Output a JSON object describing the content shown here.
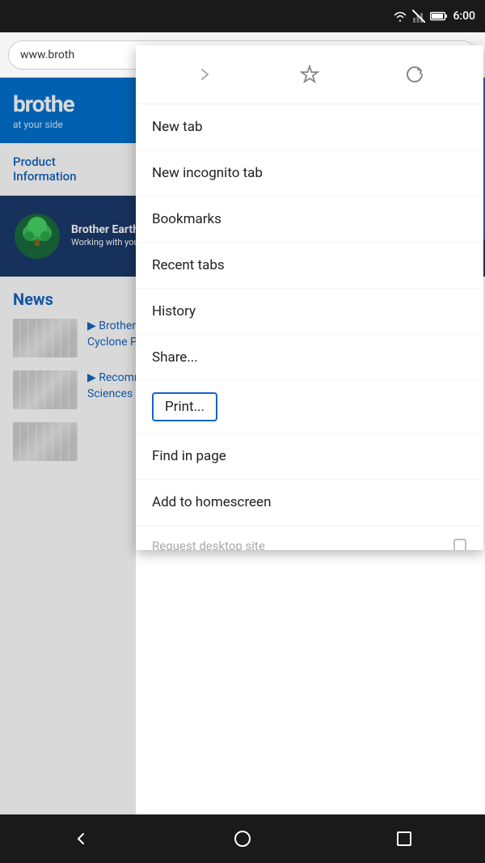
{
  "statusBar": {
    "time": "6:00",
    "wifiIcon": "wifi-icon",
    "batteryIcon": "battery-icon",
    "signalIcon": "signal-icon"
  },
  "browser": {
    "urlText": "www.broth"
  },
  "page": {
    "brotherLogo": "brothe",
    "brotherTagline": "at your side",
    "navLink": "Product",
    "navLink2": "Information",
    "earthTitle": "Brother Earth",
    "earthText": "Working with you for a better environment",
    "newsTitle": "News",
    "newsItem1": "▶ Brother Do... Cyclone Pam...",
    "newsItem2": "▶ Recomme... Sciences plc..."
  },
  "menu": {
    "forwardIcon": "→",
    "bookmarkIcon": "☆",
    "refreshIcon": "↺",
    "items": [
      {
        "label": "New tab"
      },
      {
        "label": "New incognito tab"
      },
      {
        "label": "Bookmarks"
      },
      {
        "label": "Recent tabs"
      },
      {
        "label": "History"
      },
      {
        "label": "Share..."
      },
      {
        "label": "Print...",
        "highlighted": true
      },
      {
        "label": "Find in page"
      },
      {
        "label": "Add to homescreen"
      },
      {
        "label": "Request desktop site",
        "partial": true
      }
    ]
  },
  "bottomNav": {
    "backIcon": "◁",
    "homeIcon": "○",
    "recentIcon": "□"
  }
}
